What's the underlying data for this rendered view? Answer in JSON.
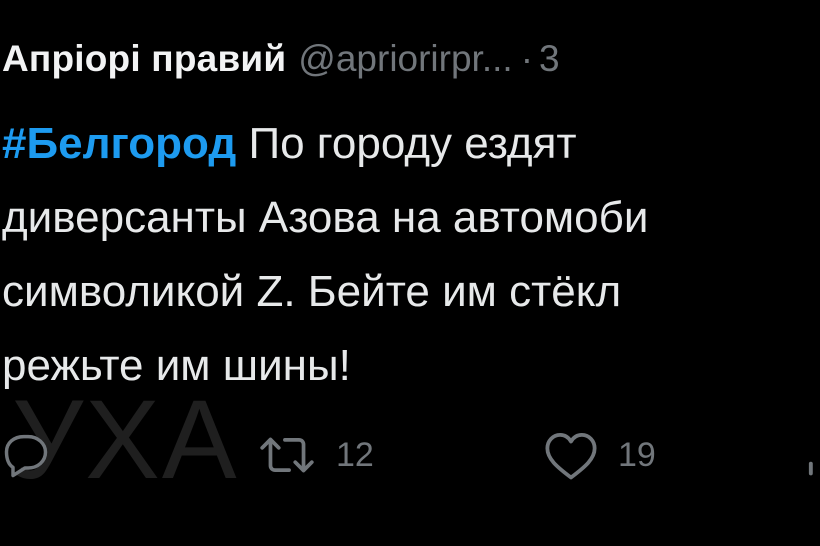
{
  "tweet": {
    "author_name": "Апріорі правий",
    "author_handle": "@apriorirpr...",
    "separator": "·",
    "timestamp": "3",
    "text": {
      "hashtag": "#Белгород",
      "line1_rest": " По городу ездят",
      "line2": "диверсанты Азова на автомоби",
      "line3": "символикой Z. Бейте им стёкл",
      "line4": "режьте им шины!"
    },
    "watermark": "УХА"
  },
  "actions": {
    "reply": {
      "icon": "reply-icon"
    },
    "retweet": {
      "icon": "retweet-icon",
      "count": "12"
    },
    "like": {
      "icon": "heart-icon",
      "count": "19"
    },
    "share": {
      "icon": "share-icon"
    }
  },
  "colors": {
    "background": "#000000",
    "text": "#e7e9ea",
    "secondary": "#71767b",
    "hashtag": "#1d9bf0"
  }
}
